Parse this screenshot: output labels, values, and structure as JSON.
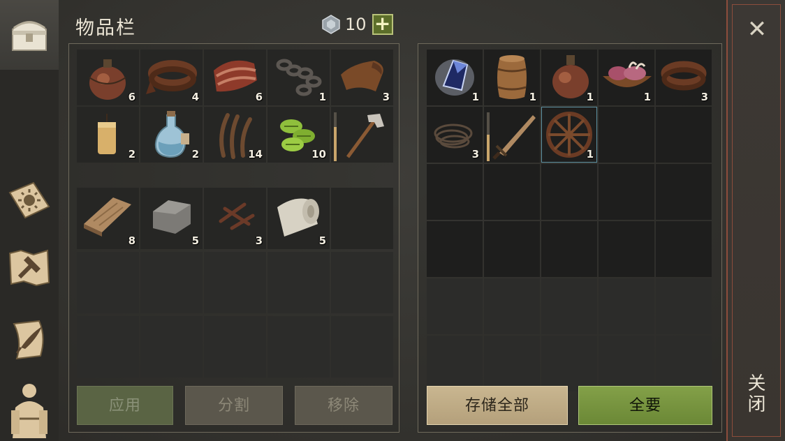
{
  "header": {
    "title": "物品栏",
    "currency_icon": "silver-gem-icon",
    "currency_count": "10",
    "add_label": "+"
  },
  "sidebar": {
    "items": [
      {
        "name": "chest-tab",
        "icon": "chest-icon"
      },
      {
        "name": "sun-journal-tab",
        "icon": "sun-book-icon"
      },
      {
        "name": "build-tab",
        "icon": "hammer-map-icon"
      },
      {
        "name": "quest-tab",
        "icon": "scroll-quill-icon"
      },
      {
        "name": "character-tab",
        "icon": "character-silhouette-icon"
      }
    ]
  },
  "inventory": {
    "pocket_items": [
      {
        "icon": "flask-icon",
        "qty": "6"
      },
      {
        "icon": "leather-icon",
        "qty": "4"
      },
      {
        "icon": "raw-meat-icon",
        "qty": "6"
      },
      {
        "icon": "chain-icon",
        "qty": "1"
      },
      {
        "icon": "hide-icon",
        "qty": "3"
      },
      {
        "icon": "candle-icon",
        "qty": "2"
      },
      {
        "icon": "water-bottle-icon",
        "qty": "2"
      },
      {
        "icon": "fiber-icon",
        "qty": "14"
      },
      {
        "icon": "herb-icon",
        "qty": "10"
      },
      {
        "icon": "hammer-icon",
        "qty": "",
        "durability": 0.7
      }
    ],
    "bag_items": [
      {
        "icon": "wood-plank-icon",
        "qty": "8"
      },
      {
        "icon": "stone-icon",
        "qty": "5"
      },
      {
        "icon": "nails-icon",
        "qty": "3"
      },
      {
        "icon": "cloth-icon",
        "qty": "5"
      }
    ]
  },
  "storage": {
    "items": [
      {
        "icon": "crystal-icon",
        "qty": "1"
      },
      {
        "icon": "barrel-icon",
        "qty": "1"
      },
      {
        "icon": "flask-icon",
        "qty": "1"
      },
      {
        "icon": "meat-bowl-icon",
        "qty": "1"
      },
      {
        "icon": "leather-icon",
        "qty": "3"
      },
      {
        "icon": "rope-icon",
        "qty": "3"
      },
      {
        "icon": "sword-icon",
        "qty": "",
        "durability": 0.55
      },
      {
        "icon": "cart-wheel-icon",
        "qty": "1"
      }
    ]
  },
  "buttons": {
    "apply": "应用",
    "split": "分割",
    "remove": "移除",
    "store_all": "存储全部",
    "take_all": "全要"
  },
  "close": {
    "icon": "close-icon",
    "label": "关闭"
  },
  "colors": {
    "accent_red": "#8d4d3c",
    "button_green": "#6b8836",
    "button_tan": "#b4a07b"
  }
}
